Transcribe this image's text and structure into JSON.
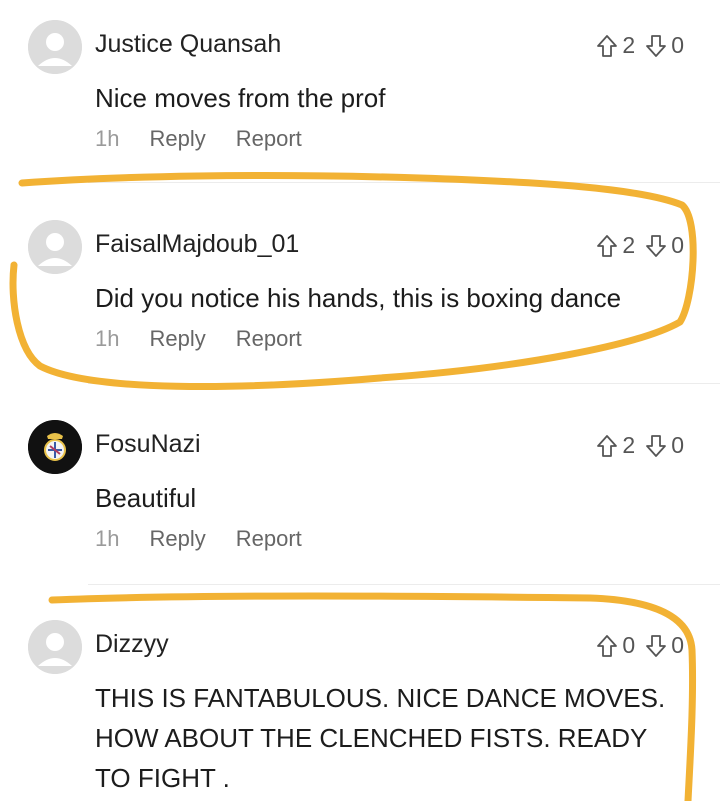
{
  "comments": [
    {
      "username": "Justice Quansah",
      "text": "Nice moves from the prof",
      "time": "1h",
      "reply": "Reply",
      "report": "Report",
      "upvotes": "2",
      "downvotes": "0"
    },
    {
      "username": "FaisalMajdoub_01",
      "text": "Did you notice his hands, this is boxing dance",
      "time": "1h",
      "reply": "Reply",
      "report": "Report",
      "upvotes": "2",
      "downvotes": "0"
    },
    {
      "username": "FosuNazi",
      "text": "Beautiful",
      "time": "1h",
      "reply": "Reply",
      "report": "Report",
      "upvotes": "2",
      "downvotes": "0"
    },
    {
      "username": "Dizzyy",
      "text": "THIS IS FANTABULOUS. NICE DANCE MOVES. HOW ABOUT THE CLENCHED FISTS. READY TO FIGHT .",
      "upvotes": "0",
      "downvotes": "0"
    }
  ],
  "icons": {
    "upvote": "arrow-up-outline-icon",
    "downvote": "arrow-down-outline-icon"
  },
  "colors": {
    "highlight_annotation": "#f2b234",
    "avatar_placeholder": "#dcdcdc"
  }
}
